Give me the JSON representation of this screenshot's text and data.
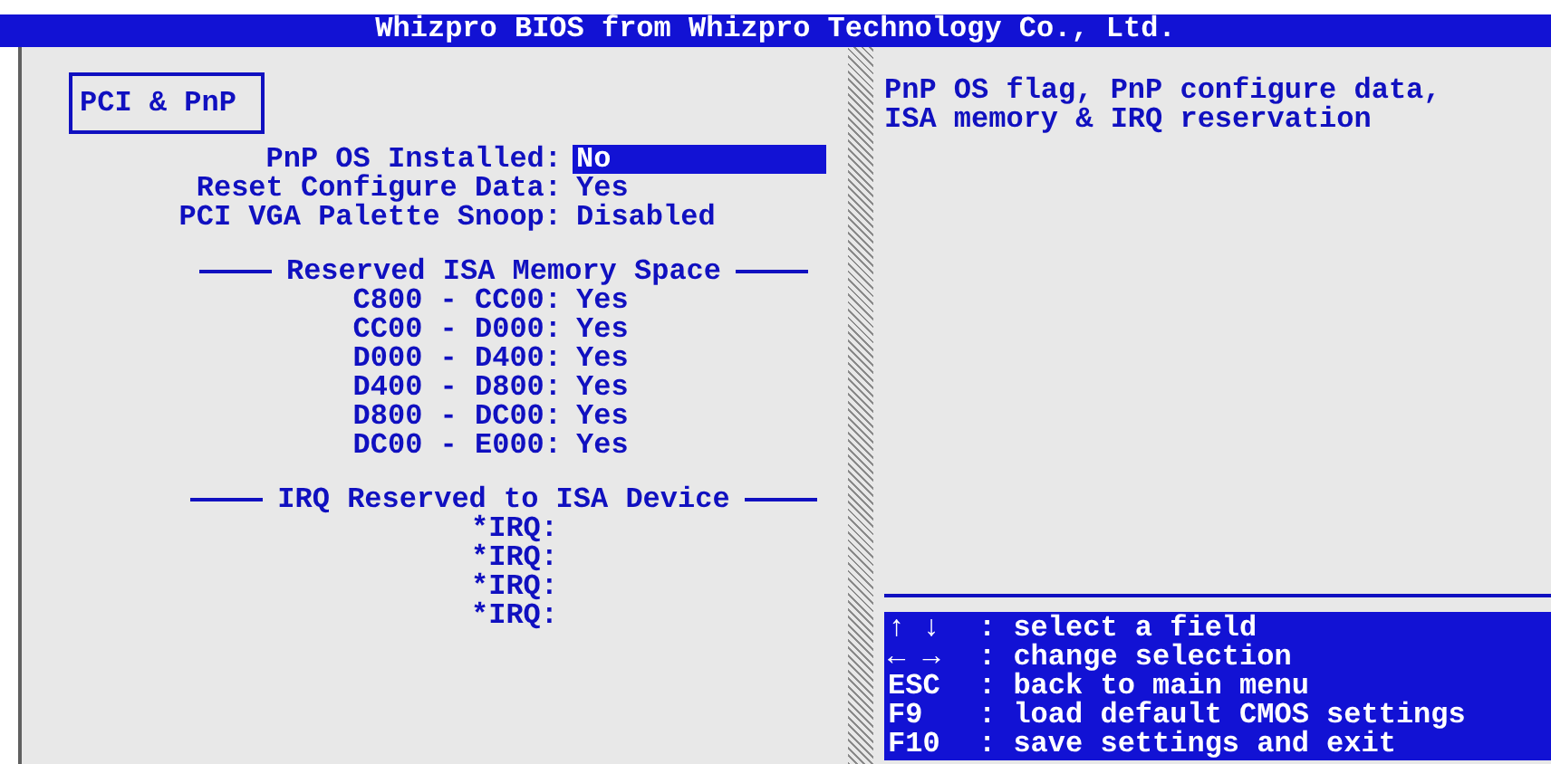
{
  "window": {
    "title": "Whizpro BIOS from Whizpro Technology Co., Ltd."
  },
  "menu_title": "PCI & PnP",
  "fields": [
    {
      "label": "PnP OS Installed:",
      "value": "No",
      "selected": true
    },
    {
      "label": "Reset Configure Data:",
      "value": "Yes",
      "selected": false
    },
    {
      "label": "PCI VGA Palette Snoop:",
      "value": "Disabled",
      "selected": false
    }
  ],
  "memory": {
    "heading": "Reserved ISA Memory Space",
    "rows": [
      {
        "label": "C800 - CC00:",
        "value": "Yes"
      },
      {
        "label": "CC00 - D000:",
        "value": "Yes"
      },
      {
        "label": "D000 - D400:",
        "value": "Yes"
      },
      {
        "label": "D400 - D800:",
        "value": "Yes"
      },
      {
        "label": "D800 - DC00:",
        "value": "Yes"
      },
      {
        "label": "DC00 - E000:",
        "value": "Yes"
      }
    ]
  },
  "irq": {
    "heading": "IRQ Reserved to ISA Device",
    "rows": [
      {
        "label": "*IRQ:"
      },
      {
        "label": "*IRQ:"
      },
      {
        "label": "*IRQ:"
      },
      {
        "label": "*IRQ:"
      }
    ]
  },
  "help_text": "PnP OS flag, PnP configure data, ISA memory & IRQ reservation",
  "keys": [
    {
      "key": "↑ ↓",
      "action": ": select a field"
    },
    {
      "key": "← →",
      "action": ": change selection"
    },
    {
      "key": "ESC",
      "action": ": back to main menu"
    },
    {
      "key": "F9",
      "action": ": load default CMOS settings"
    },
    {
      "key": "F10",
      "action": ": save settings and exit"
    }
  ]
}
